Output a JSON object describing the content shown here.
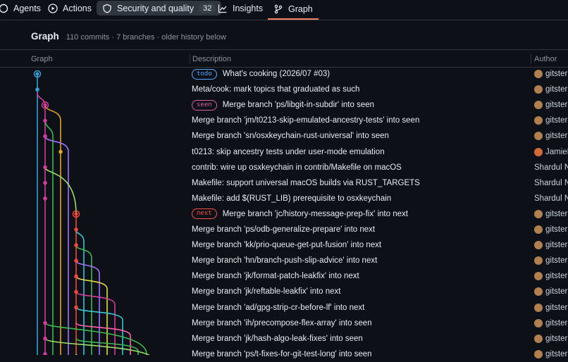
{
  "nav": {
    "tabs": [
      {
        "label": "Agents",
        "icon": "agent-icon"
      },
      {
        "label": "Actions",
        "icon": "play-icon"
      },
      {
        "label": "Security and quality",
        "icon": "shield-icon",
        "count": "32"
      },
      {
        "label": "Insights",
        "icon": "graph-icon"
      },
      {
        "label": "Graph",
        "icon": "git-branch-icon",
        "active": true
      }
    ]
  },
  "page": {
    "title": "Graph",
    "subtitle": "110 commits · 7 branches · older history below"
  },
  "columns": {
    "graph": "Graph",
    "description": "Description",
    "author": "Author"
  },
  "badge_colors": {
    "todo": "#58a6ff",
    "seen": "#db61a2",
    "next": "#f85149"
  },
  "commits": [
    {
      "badge": "todo",
      "message": "What's cooking (2026/07 #03)",
      "author": "gitster",
      "avatar": true
    },
    {
      "badge": "",
      "message": "Meta/cook: mark topics that graduated as such",
      "author": "gitster",
      "avatar": true
    },
    {
      "badge": "seen",
      "message": "Merge branch 'ps/libgit-in-subdir' into seen",
      "author": "gitster",
      "avatar": true
    },
    {
      "badge": "",
      "message": "Merge branch 'jm/t0213-skip-emulated-ancestry-tests' into seen",
      "author": "gitster",
      "avatar": true
    },
    {
      "badge": "",
      "message": "Merge branch 'sn/osxkeychain-rust-universal' into seen",
      "author": "gitster",
      "avatar": true
    },
    {
      "badge": "",
      "message": "t0213: skip ancestry tests under user-mode emulation",
      "author": "JamieM",
      "avatar": true
    },
    {
      "badge": "",
      "message": "contrib: wire up osxkeychain in contrib/Makefile on macOS",
      "author": "Shardul Na",
      "avatar": false
    },
    {
      "badge": "",
      "message": "Makefile: support universal macOS builds via RUST_TARGETS",
      "author": "Shardul Na",
      "avatar": false
    },
    {
      "badge": "",
      "message": "Makefile: add $(RUST_LIB) prerequisite to osxkeychain",
      "author": "Shardul Na",
      "avatar": false
    },
    {
      "badge": "next",
      "message": "Merge branch 'jc/history-message-prep-fix' into next",
      "author": "gitster",
      "avatar": true
    },
    {
      "badge": "",
      "message": "Merge branch 'ps/odb-generalize-prepare' into next",
      "author": "gitster",
      "avatar": true
    },
    {
      "badge": "",
      "message": "Merge branch 'kk/prio-queue-get-put-fusion' into next",
      "author": "gitster",
      "avatar": true
    },
    {
      "badge": "",
      "message": "Merge branch 'hn/branch-push-slip-advice' into next",
      "author": "gitster",
      "avatar": true
    },
    {
      "badge": "",
      "message": "Merge branch 'jk/format-patch-leakfix' into next",
      "author": "gitster",
      "avatar": true
    },
    {
      "badge": "",
      "message": "Merge branch 'jk/reftable-leakfix' into next",
      "author": "gitster",
      "avatar": true
    },
    {
      "badge": "",
      "message": "Merge branch 'ad/gpg-strip-cr-before-lf' into next",
      "author": "gitster",
      "avatar": true
    },
    {
      "badge": "",
      "message": "Merge branch 'ih/precompose-flex-array' into seen",
      "author": "gitster",
      "avatar": true
    },
    {
      "badge": "",
      "message": "Merge branch 'jk/hash-algo-leak-fixes' into seen",
      "author": "gitster",
      "avatar": true
    },
    {
      "badge": "",
      "message": "Merge branch 'ps/t-fixes-for-git-test-long' into seen",
      "author": "gitster",
      "avatar": true
    }
  ]
}
